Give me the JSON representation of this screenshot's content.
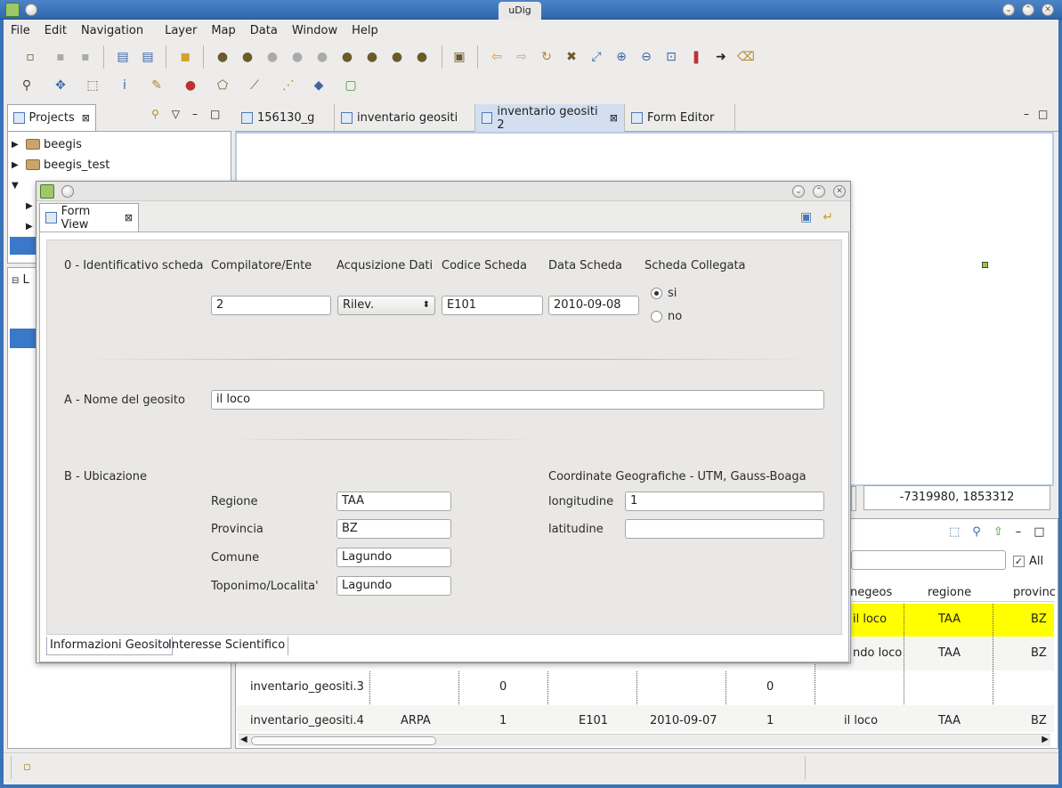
{
  "window": {
    "title": "uDig"
  },
  "menu": [
    "File",
    "Edit",
    "Navigation",
    "Layer",
    "Map",
    "Data",
    "Window",
    "Help"
  ],
  "projects_panel": {
    "tab_label": "Projects",
    "items": [
      "beegis",
      "beegis_test"
    ],
    "second_tab_partial": "L"
  },
  "editor_tabs": [
    "156130_g",
    "inventario geositi",
    "inventario geositi 2",
    "Form Editor"
  ],
  "map": {
    "coordinates": "-7319980, 1853312"
  },
  "attribute_table": {
    "all_label": "All",
    "headers": [
      "negeos",
      "regione",
      "provinc"
    ],
    "rows": [
      {
        "cells": [
          "il loco",
          "TAA",
          "BZ"
        ]
      },
      {
        "cells": [
          "ndo loco",
          "TAA",
          "BZ"
        ]
      },
      {
        "cells": [
          "inventario_geositi.3",
          "",
          "0",
          "",
          "",
          "0",
          "",
          "",
          ""
        ]
      },
      {
        "cells": [
          "inventario_geositi.4",
          "ARPA",
          "1",
          "E101",
          "2010-09-07",
          "1",
          "il loco",
          "TAA",
          "BZ"
        ]
      }
    ]
  },
  "form_view": {
    "tab_label": "Form View",
    "section0": {
      "label": "0 - Identificativo scheda",
      "compilatore_label": "Compilatore/Ente",
      "compilatore_value": "2",
      "acquisizione_label": "Acqusizione Dati",
      "acquisizione_value": "Rilev.",
      "codice_label": "Codice Scheda",
      "codice_value": "E101",
      "data_label": "Data Scheda",
      "data_value": "2010-09-08",
      "collegata_label": "Scheda Collegata",
      "radio_si": "si",
      "radio_no": "no"
    },
    "sectionA": {
      "label": "A - Nome del geosito",
      "value": "il loco"
    },
    "sectionB": {
      "label": "B - Ubicazione",
      "regione_label": "Regione",
      "regione_value": "TAA",
      "provincia_label": "Provincia",
      "provincia_value": "BZ",
      "comune_label": "Comune",
      "comune_value": "Lagundo",
      "toponimo_label": "Toponimo/Localita'",
      "toponimo_value": "Lagundo",
      "coord_label": "Coordinate Geografiche - UTM, Gauss-Boaga",
      "longitudine_label": "longitudine",
      "longitudine_value": "1",
      "latitudine_label": "latitudine",
      "latitudine_value": ""
    },
    "bottom_tabs": [
      "Informazioni Geosito",
      "Interesse Scientifico"
    ]
  },
  "colors": {
    "selected_row": "#ffff00",
    "title_bar": "#3a73b8",
    "active_tab": "#d3dff0"
  }
}
